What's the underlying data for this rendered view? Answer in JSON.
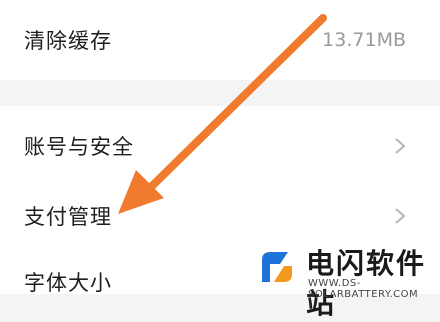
{
  "settings": {
    "clear_cache": {
      "label": "清除缓存",
      "value": "13.71MB"
    },
    "account_security": {
      "label": "账号与安全"
    },
    "payment_management": {
      "label": "支付管理"
    },
    "font_size": {
      "label": "字体大小"
    }
  },
  "icons": {
    "chevron": "chevron-right-icon",
    "annotation": "orange-arrow"
  },
  "colors": {
    "arrow": "#f07a2e",
    "background": "#f4f4f4",
    "row": "#ffffff"
  },
  "watermark": {
    "title": "电闪软件站",
    "subtitle": "WWW.DS-SOLARBATTERY.COM"
  }
}
